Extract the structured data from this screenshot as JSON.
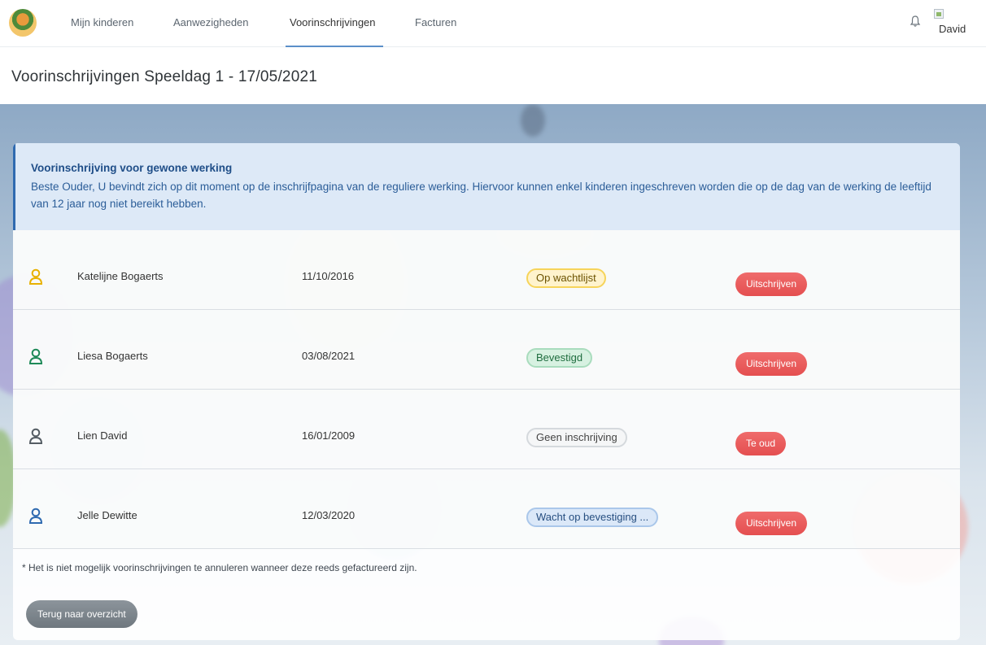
{
  "nav": {
    "items": [
      {
        "label": "Mijn kinderen",
        "active": false
      },
      {
        "label": "Aanwezigheden",
        "active": false
      },
      {
        "label": "Voorinschrijvingen",
        "active": true
      },
      {
        "label": "Facturen",
        "active": false
      }
    ],
    "user": {
      "avatar_alt": "David",
      "notification_icon": "bell-icon"
    }
  },
  "page": {
    "title": "Voorinschrijvingen Speeldag 1 - 17/05/2021"
  },
  "alert": {
    "title": "Voorinschrijving voor gewone werking",
    "body": "Beste Ouder, U bevindt zich op dit moment op de inschrijfpagina van de reguliere werking. Hiervoor kunnen enkel kinderen ingeschreven worden die op de dag van de werking de leeftijd van 12 jaar nog niet bereikt hebben."
  },
  "children": [
    {
      "name": "Katelijne Bogaerts",
      "dob": "11/10/2016",
      "status": "Op wachtlijst",
      "status_style": "wait",
      "action": "Uitschrijven",
      "icon_color": "#e8b100"
    },
    {
      "name": "Liesa Bogaerts",
      "dob": "03/08/2021",
      "status": "Bevestigd",
      "status_style": "ok",
      "action": "Uitschrijven",
      "icon_color": "#1e8a58"
    },
    {
      "name": "Lien David",
      "dob": "16/01/2009",
      "status": "Geen inschrijving",
      "status_style": "none",
      "action": "Te oud",
      "icon_color": "#555d64"
    },
    {
      "name": "Jelle Dewitte",
      "dob": "12/03/2020",
      "status": "Wacht op bevestiging ...",
      "status_style": "pending",
      "action": "Uitschrijven",
      "icon_color": "#2f6ab0"
    }
  ],
  "footnote": "* Het is niet mogelijk voorinschrijvingen te annuleren wanneer deze reeds gefactureerd zijn.",
  "back_button": "Terug naar overzicht"
}
